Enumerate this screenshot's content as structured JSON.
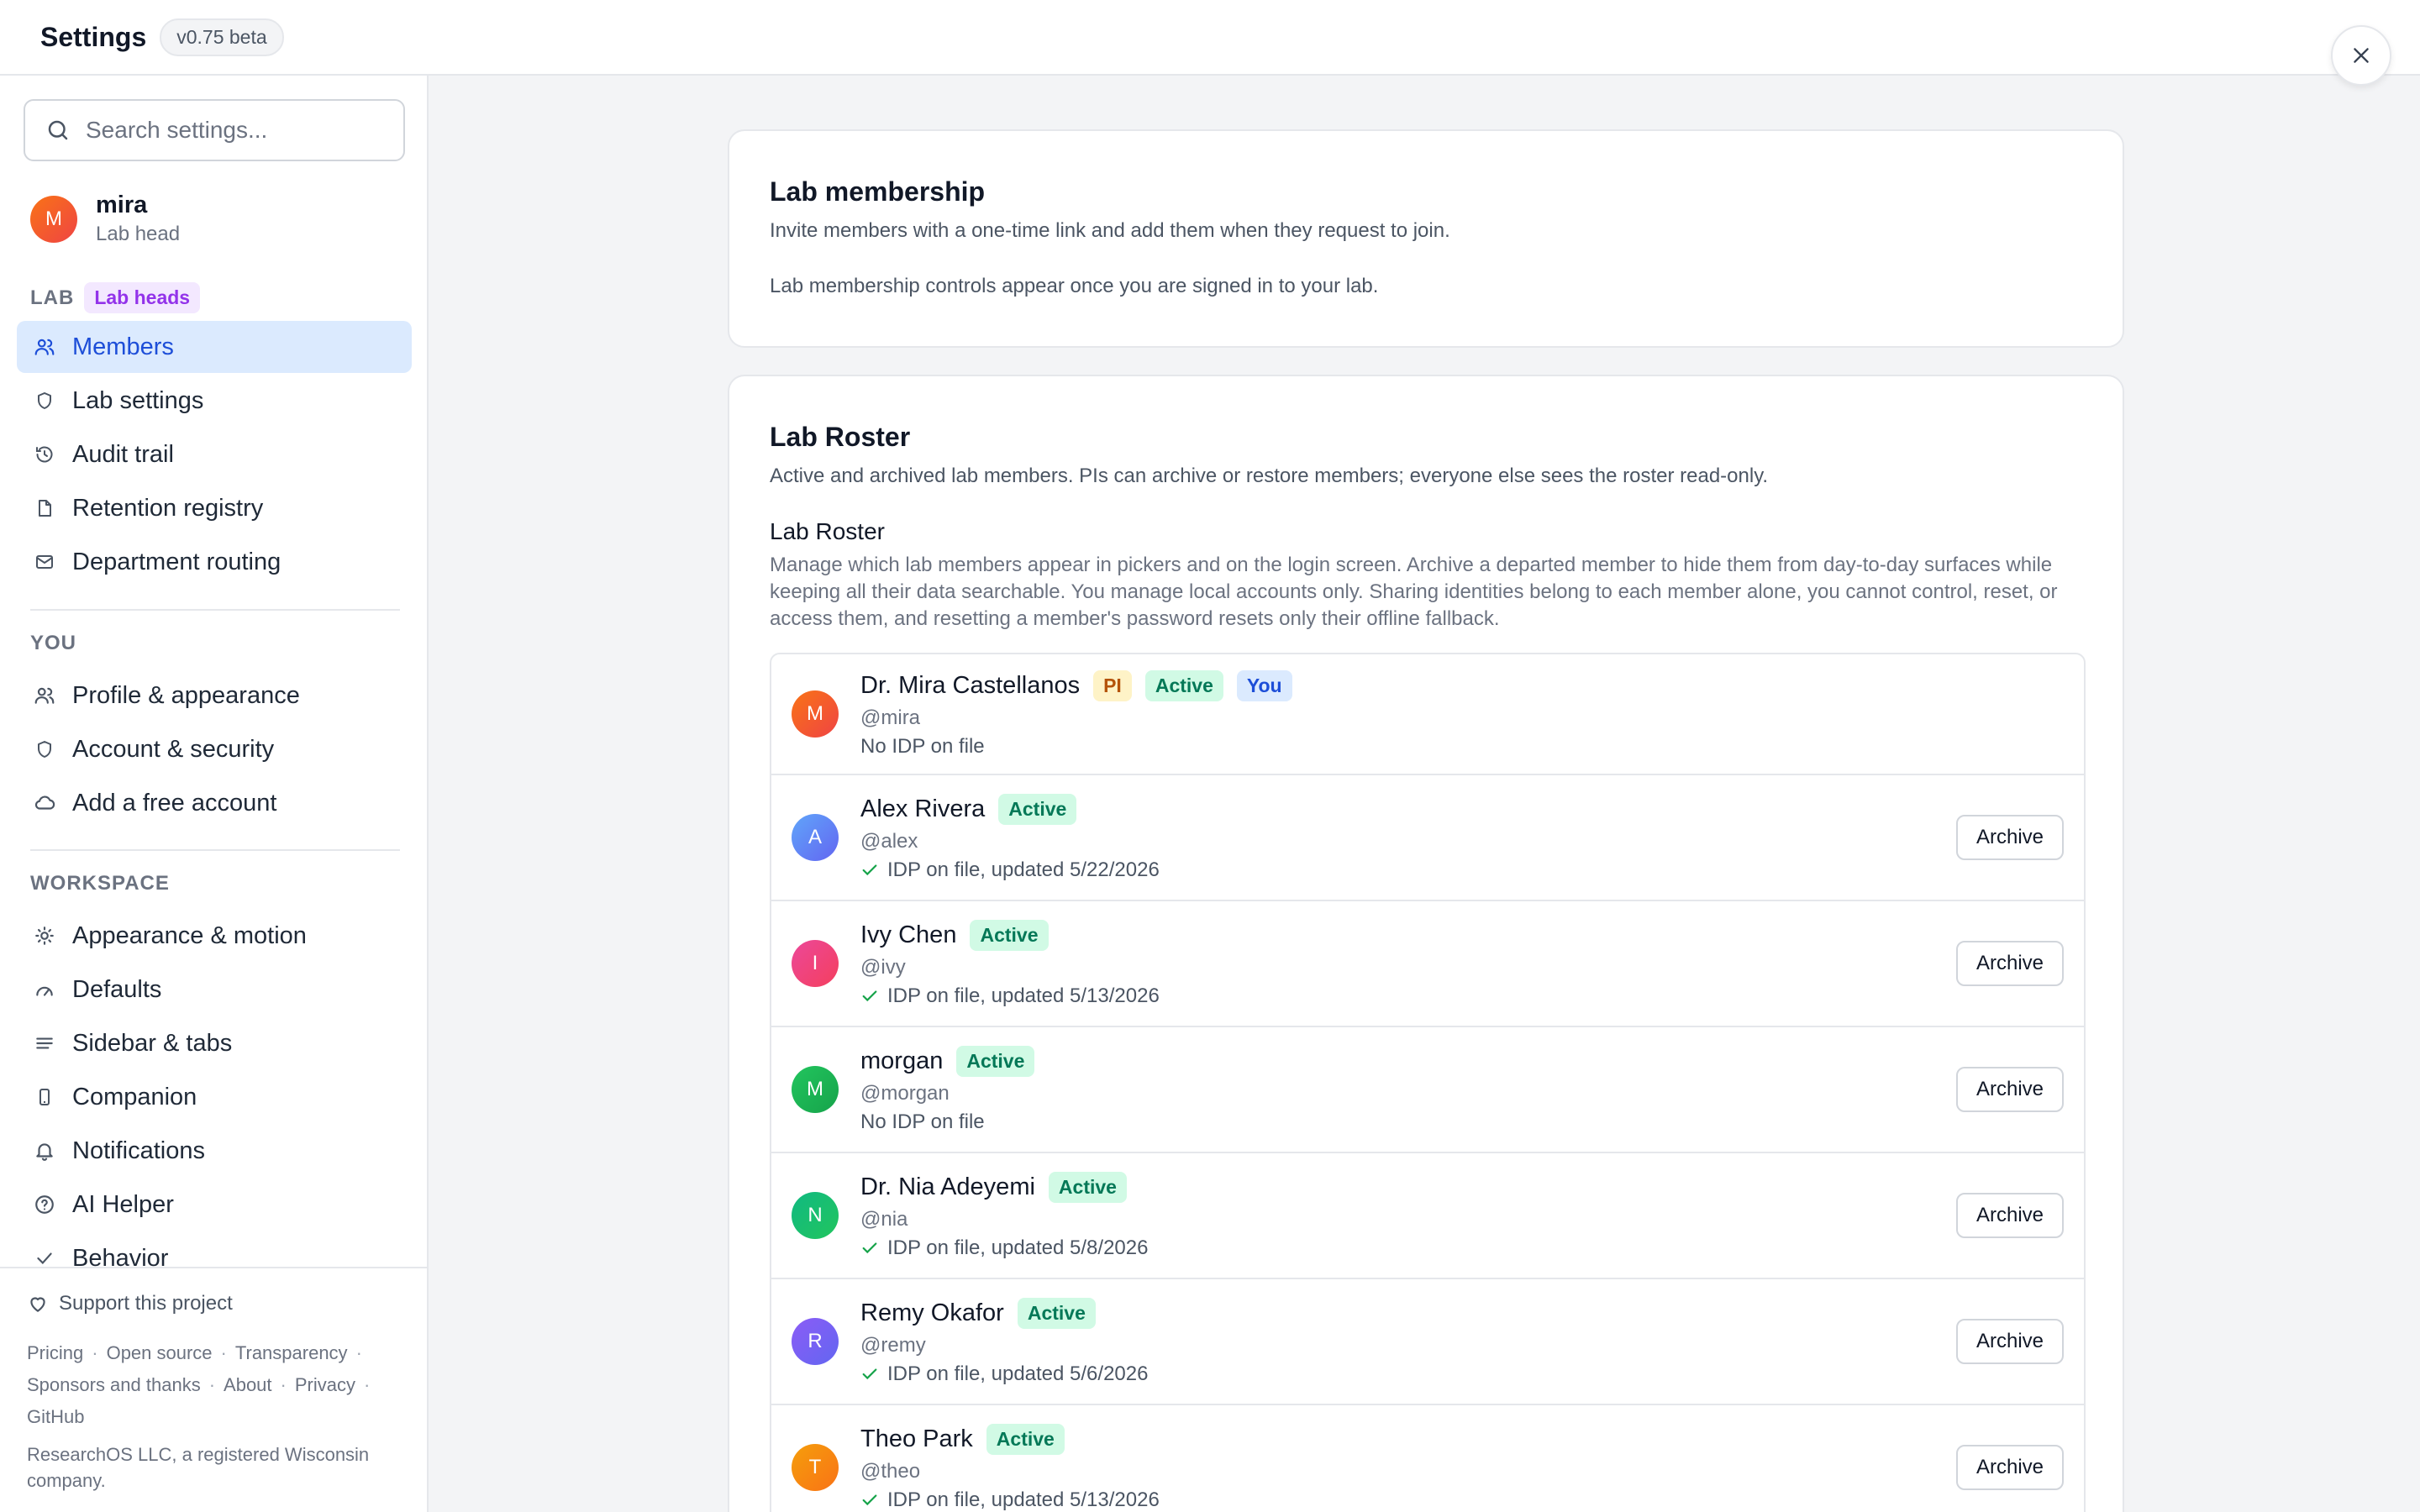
{
  "header": {
    "title": "Settings",
    "version": "v0.75 beta"
  },
  "sidebar": {
    "search_placeholder": "Search settings...",
    "user": {
      "initial": "M",
      "name": "mira",
      "role": "Lab head"
    },
    "lab_section": {
      "label": "LAB",
      "tag": "Lab heads"
    },
    "lab_items": [
      {
        "label": "Members",
        "icon": "users-icon",
        "active": true
      },
      {
        "label": "Lab settings",
        "icon": "shield-icon"
      },
      {
        "label": "Audit trail",
        "icon": "history-icon"
      },
      {
        "label": "Retention registry",
        "icon": "file-icon"
      },
      {
        "label": "Department routing",
        "icon": "mail-icon"
      }
    ],
    "you_section": {
      "label": "YOU"
    },
    "you_items": [
      {
        "label": "Profile & appearance",
        "icon": "users-icon"
      },
      {
        "label": "Account & security",
        "icon": "shield-icon"
      },
      {
        "label": "Add a free account",
        "icon": "cloud-icon"
      }
    ],
    "workspace_section": {
      "label": "WORKSPACE"
    },
    "workspace_items": [
      {
        "label": "Appearance & motion",
        "icon": "sun-icon"
      },
      {
        "label": "Defaults",
        "icon": "gauge-icon"
      },
      {
        "label": "Sidebar & tabs",
        "icon": "menu-lines-icon"
      },
      {
        "label": "Companion",
        "icon": "phone-icon"
      },
      {
        "label": "Notifications",
        "icon": "bell-icon"
      },
      {
        "label": "AI Helper",
        "icon": "help-circle-icon"
      },
      {
        "label": "Behavior",
        "icon": "check-icon"
      }
    ],
    "footer": {
      "support": "Support this project",
      "links": [
        "Pricing",
        "Open source",
        "Transparency",
        "Sponsors and thanks",
        "About",
        "Privacy",
        "GitHub"
      ],
      "company": "ResearchOS LLC, a registered Wisconsin company."
    }
  },
  "membership_card": {
    "title": "Lab membership",
    "description": "Invite members with a one-time link and add them when they request to join.",
    "note": "Lab membership controls appear once you are signed in to your lab."
  },
  "roster_card": {
    "title": "Lab Roster",
    "description": "Active and archived lab members. PIs can archive or restore members; everyone else sees the roster read-only.",
    "subtitle": "Lab Roster",
    "long_description": "Manage which lab members appear in pickers and on the login screen. Archive a departed member to hide them from day-to-day surfaces while keeping all their data searchable. You manage local accounts only. Sharing identities belong to each member alone, you cannot control, reset, or access them, and resetting a member's password resets only their offline fallback.",
    "archive_label": "Archive",
    "members": [
      {
        "initial": "M",
        "name": "Dr. Mira Castellanos",
        "handle": "@mira",
        "idp": "No IDP on file",
        "idp_on_file": false,
        "status": "Active",
        "pi_badge": "PI",
        "you_badge": "You",
        "color": "#f97316"
      },
      {
        "initial": "A",
        "name": "Alex Rivera",
        "handle": "@alex",
        "idp": "IDP on file, updated 5/22/2026",
        "idp_on_file": true,
        "status": "Active",
        "color": "#3b82f6"
      },
      {
        "initial": "I",
        "name": "Ivy Chen",
        "handle": "@ivy",
        "idp": "IDP on file, updated 5/13/2026",
        "idp_on_file": true,
        "status": "Active",
        "color": "#ec4899"
      },
      {
        "initial": "M",
        "name": "morgan",
        "handle": "@morgan",
        "idp": "No IDP on file",
        "idp_on_file": false,
        "status": "Active",
        "color": "#22c55e"
      },
      {
        "initial": "N",
        "name": "Dr. Nia Adeyemi",
        "handle": "@nia",
        "idp": "IDP on file, updated 5/8/2026",
        "idp_on_file": true,
        "status": "Active",
        "color": "#10b981"
      },
      {
        "initial": "R",
        "name": "Remy Okafor",
        "handle": "@remy",
        "idp": "IDP on file, updated 5/6/2026",
        "idp_on_file": true,
        "status": "Active",
        "color": "#8b5cf6"
      },
      {
        "initial": "T",
        "name": "Theo Park",
        "handle": "@theo",
        "idp": "IDP on file, updated 5/13/2026",
        "idp_on_file": true,
        "status": "Active",
        "color": "#f59e0b"
      }
    ]
  }
}
